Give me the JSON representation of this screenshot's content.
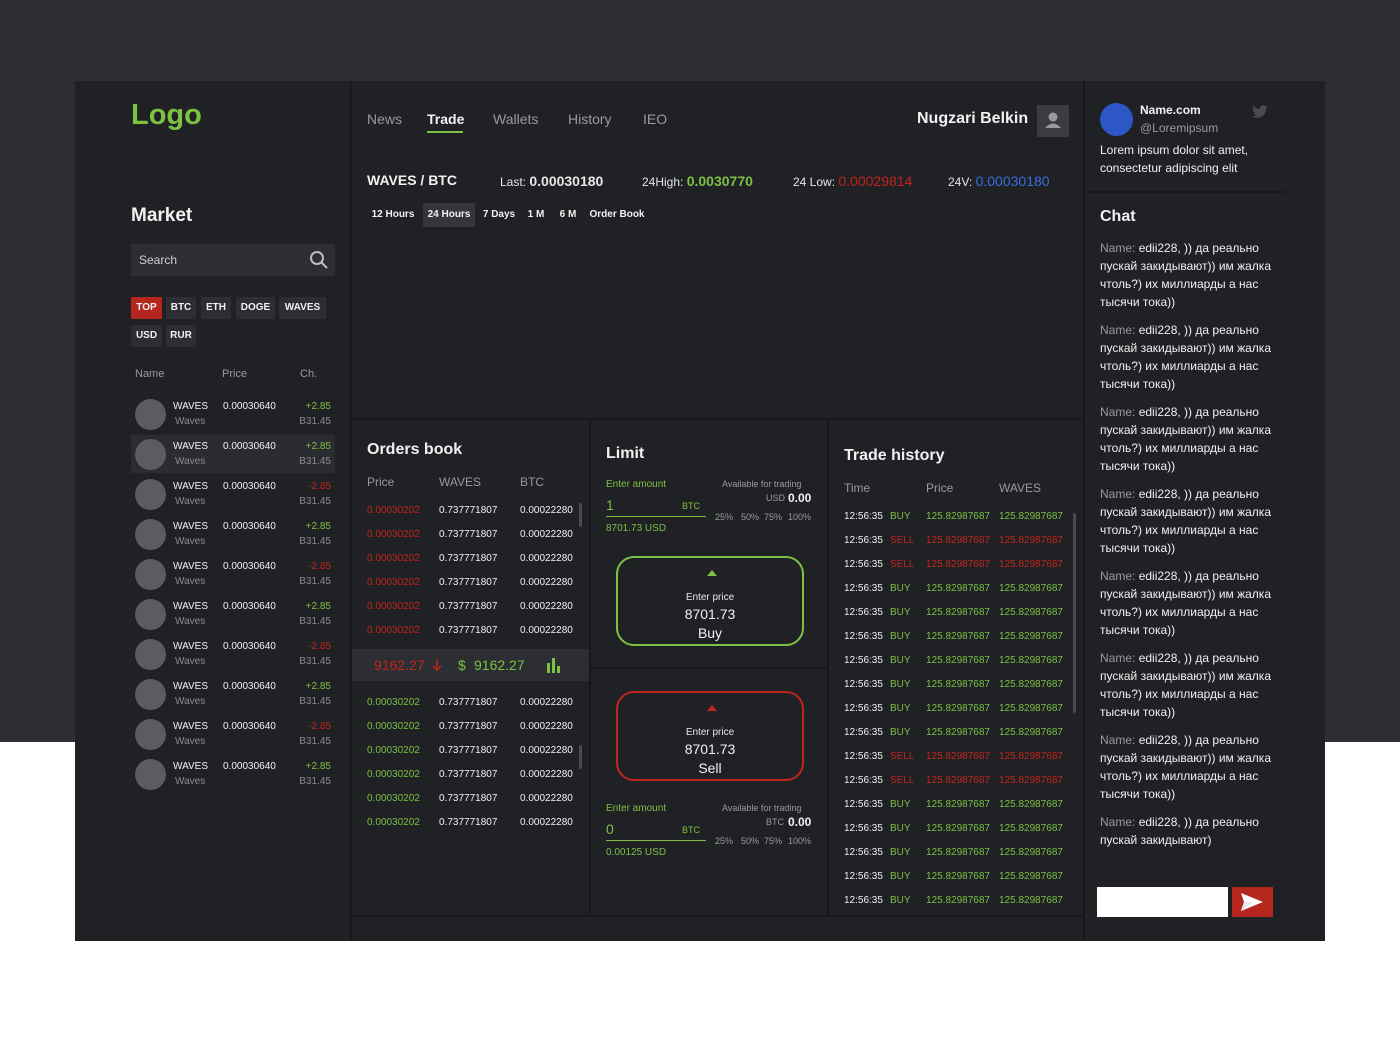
{
  "sidebar": {
    "logo": "Logo",
    "market_title": "Market",
    "search_placeholder": "Search",
    "filters": [
      "TOP",
      "BTC",
      "ETH",
      "DOGE",
      "WAVES",
      "USD",
      "RUR"
    ],
    "columns": [
      "Name",
      "Price",
      "Ch."
    ],
    "rows": [
      {
        "symbol": "WAVES",
        "sub": "Waves",
        "price": "0.00030640",
        "change": "+2.85",
        "vol": "B31.45",
        "dir": "up"
      },
      {
        "symbol": "WAVES",
        "sub": "Waves",
        "price": "0.00030640",
        "change": "+2.85",
        "vol": "B31.45",
        "dir": "up"
      },
      {
        "symbol": "WAVES",
        "sub": "Waves",
        "price": "0.00030640",
        "change": "-2.85",
        "vol": "B31.45",
        "dir": "down"
      },
      {
        "symbol": "WAVES",
        "sub": "Waves",
        "price": "0.00030640",
        "change": "+2.85",
        "vol": "B31.45",
        "dir": "up"
      },
      {
        "symbol": "WAVES",
        "sub": "Waves",
        "price": "0.00030640",
        "change": "-2.85",
        "vol": "B31.45",
        "dir": "down"
      },
      {
        "symbol": "WAVES",
        "sub": "Waves",
        "price": "0.00030640",
        "change": "+2.85",
        "vol": "B31.45",
        "dir": "up"
      },
      {
        "symbol": "WAVES",
        "sub": "Waves",
        "price": "0.00030640",
        "change": "-2.85",
        "vol": "B31.45",
        "dir": "down"
      },
      {
        "symbol": "WAVES",
        "sub": "Waves",
        "price": "0.00030640",
        "change": "+2.85",
        "vol": "B31.45",
        "dir": "up"
      },
      {
        "symbol": "WAVES",
        "sub": "Waves",
        "price": "0.00030640",
        "change": "-2.85",
        "vol": "B31.45",
        "dir": "down"
      },
      {
        "symbol": "WAVES",
        "sub": "Waves",
        "price": "0.00030640",
        "change": "+2.85",
        "vol": "B31.45",
        "dir": "up"
      }
    ]
  },
  "nav": {
    "items": [
      "News",
      "Trade",
      "Wallets",
      "History",
      "IEO"
    ],
    "active": "Trade",
    "username": "Nugzari Belkin"
  },
  "ticker": {
    "pair": "WAVES / BTC",
    "last_label": "Last:",
    "last_value": "0.00030180",
    "high_label": "24High:",
    "high_value": "0.0030770",
    "low_label": "24 Low:",
    "low_value": "0.00029814",
    "vol_label": "24V:",
    "vol_value": "0.00030180",
    "timeframes": [
      "12 Hours",
      "24 Hours",
      "7 Days",
      "1 M",
      "6 M",
      "Order Book"
    ],
    "active_timeframe": "24 Hours"
  },
  "orders_book": {
    "title": "Orders book",
    "columns": [
      "Price",
      "WAVES",
      "BTC"
    ],
    "asks": [
      [
        "0.00030202",
        "0.737771807",
        "0.00022280"
      ],
      [
        "0.00030202",
        "0.737771807",
        "0.00022280"
      ],
      [
        "0.00030202",
        "0.737771807",
        "0.00022280"
      ],
      [
        "0.00030202",
        "0.737771807",
        "0.00022280"
      ],
      [
        "0.00030202",
        "0.737771807",
        "0.00022280"
      ],
      [
        "0.00030202",
        "0.737771807",
        "0.00022280"
      ]
    ],
    "mid_down": "9162.27",
    "mid_up": "9162.27",
    "mid_currency": "$",
    "bids": [
      [
        "0.00030202",
        "0.737771807",
        "0.00022280"
      ],
      [
        "0.00030202",
        "0.737771807",
        "0.00022280"
      ],
      [
        "0.00030202",
        "0.737771807",
        "0.00022280"
      ],
      [
        "0.00030202",
        "0.737771807",
        "0.00022280"
      ],
      [
        "0.00030202",
        "0.737771807",
        "0.00022280"
      ],
      [
        "0.00030202",
        "0.737771807",
        "0.00022280"
      ]
    ]
  },
  "limit": {
    "title": "Limit",
    "buy": {
      "enter_amount": "Enter amount",
      "available_label": "Available for trading",
      "available_currency": "USD",
      "available_value": "0.00",
      "amount": "1",
      "unit": "BTC",
      "converted": "8701.73 USD",
      "percentages": [
        "25%",
        "50%",
        "75%",
        "100%"
      ],
      "enter_price": "Enter price",
      "price": "8701.73",
      "label": "Buy"
    },
    "sell": {
      "enter_amount": "Enter amount",
      "available_label": "Available for trading",
      "available_currency": "BTC",
      "available_value": "0.00",
      "amount": "0",
      "unit": "BTC",
      "converted": "0.00125 USD",
      "percentages": [
        "25%",
        "50%",
        "75%",
        "100%"
      ],
      "enter_price": "Enter price",
      "price": "8701.73",
      "label": "Sell"
    }
  },
  "trade_history": {
    "title": "Trade history",
    "columns": [
      "Time",
      "Price",
      "WAVES"
    ],
    "rows": [
      {
        "time": "12:56:35",
        "side": "BUY",
        "price": "125.82987687",
        "amount": "125.82987687"
      },
      {
        "time": "12:56:35",
        "side": "SELL",
        "price": "125.82987687",
        "amount": "125.82987687"
      },
      {
        "time": "12:56:35",
        "side": "SELL",
        "price": "125.82987687",
        "amount": "125.82987687"
      },
      {
        "time": "12:56:35",
        "side": "BUY",
        "price": "125.82987687",
        "amount": "125.82987687"
      },
      {
        "time": "12:56:35",
        "side": "BUY",
        "price": "125.82987687",
        "amount": "125.82987687"
      },
      {
        "time": "12:56:35",
        "side": "BUY",
        "price": "125.82987687",
        "amount": "125.82987687"
      },
      {
        "time": "12:56:35",
        "side": "BUY",
        "price": "125.82987687",
        "amount": "125.82987687"
      },
      {
        "time": "12:56:35",
        "side": "BUY",
        "price": "125.82987687",
        "amount": "125.82987687"
      },
      {
        "time": "12:56:35",
        "side": "BUY",
        "price": "125.82987687",
        "amount": "125.82987687"
      },
      {
        "time": "12:56:35",
        "side": "BUY",
        "price": "125.82987687",
        "amount": "125.82987687"
      },
      {
        "time": "12:56:35",
        "side": "SELL",
        "price": "125.82987687",
        "amount": "125.82987687"
      },
      {
        "time": "12:56:35",
        "side": "SELL",
        "price": "125.82987687",
        "amount": "125.82987687"
      },
      {
        "time": "12:56:35",
        "side": "BUY",
        "price": "125.82987687",
        "amount": "125.82987687"
      },
      {
        "time": "12:56:35",
        "side": "BUY",
        "price": "125.82987687",
        "amount": "125.82987687"
      },
      {
        "time": "12:56:35",
        "side": "BUY",
        "price": "125.82987687",
        "amount": "125.82987687"
      },
      {
        "time": "12:56:35",
        "side": "BUY",
        "price": "125.82987687",
        "amount": "125.82987687"
      },
      {
        "time": "12:56:35",
        "side": "BUY",
        "price": "125.82987687",
        "amount": "125.82987687"
      }
    ]
  },
  "tweet": {
    "name": "Name.com",
    "handle": "@Loremipsum",
    "text": "Lorem ipsum dolor sit amet, consectetur adipiscing elit"
  },
  "chat": {
    "title": "Chat",
    "messages": [
      {
        "name": "Name:",
        "text": "edii228, )) да реально пускай закидывают)) им жалка чтоль?) их миллиарды а нас тысячи тока))"
      },
      {
        "name": "Name:",
        "text": "edii228, )) да реально пускай закидывают)) им жалка чтоль?) их миллиарды а нас тысячи тока))"
      },
      {
        "name": "Name:",
        "text": "edii228, )) да реально пускай закидывают)) им жалка чтоль?) их миллиарды а нас тысячи тока))"
      },
      {
        "name": "Name:",
        "text": "edii228, )) да реально пускай закидывают)) им жалка чтоль?) их миллиарды а нас тысячи тока))"
      },
      {
        "name": "Name:",
        "text": "edii228, )) да реально пускай закидывают)) им жалка чтоль?) их миллиарды а нас тысячи тока))"
      },
      {
        "name": "Name:",
        "text": "edii228, )) да реально пускай закидывают)) им жалка чтоль?) их миллиарды а нас тысячи тока))"
      },
      {
        "name": "Name:",
        "text": "edii228, )) да реально пускай закидывают)) им жалка чтоль?) их миллиарды а нас тысячи тока))"
      },
      {
        "name": "Name:",
        "text": "edii228, )) да реально пускай закидывают)"
      }
    ],
    "input_value": ""
  },
  "colors": {
    "green": "#7cc142",
    "red": "#c0251c",
    "blue": "#3a6fe0",
    "panel": "#1f2125",
    "background": "#2c2e34"
  },
  "icons": [
    "search-icon",
    "user-icon",
    "twitter-icon",
    "arrow-down-icon",
    "bar-chart-icon",
    "send-icon",
    "triangle-up-icon"
  ]
}
